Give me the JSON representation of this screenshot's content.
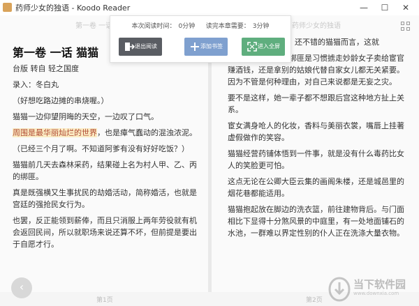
{
  "window": {
    "title": "药师少女的独语 - Koodo Reader",
    "controls": [
      "—",
      "☐",
      "✕"
    ]
  },
  "header_left": "第一卷 一话",
  "header_right": "药师少女的独语",
  "toolbar": {
    "read_time_label": "本次阅读时间：",
    "read_time_value": "0分钟",
    "remaining_label": "读完本章需要：",
    "remaining_value": "3分钟",
    "exit_label": "退出阅读",
    "bookmark_label": "添加书签",
    "fullscreen_label": "进入全屏"
  },
  "left_page": {
    "chapter_title": "第一卷 一话 猫猫",
    "paragraphs": [
      "台版 转自 轻之国度",
      "录入：冬白丸",
      "（好想吃路边摊的串烧喔。）",
      "猫猫一边仰望阴晦的天空，一边叹了口气。",
      "也是瘴气蠢动的混浊浓泥。",
      "（已经三个月了啊。不知道阿爹有没有好好吃饭？）",
      "猫猫前几天去森林采药，结果碰上名为村人甲、乙、丙的绑匪。",
      "真是既强横又生事扰民的劫婚活动，简称婚活，也就是宫廷的强抢民女行为。",
      "也罢，反正能领到薪俸，而且只消服上两年劳役就有机会返回民间，所以就职场来说还算不坏，但前提是要出于自愿才行。"
    ],
    "highlight": "周围是最华丽灿烂的世界",
    "page_label": "第1页"
  },
  "right_page": {
    "top_fragment": "还不错的猫猫而言，这就",
    "paragraphs": [
      "对猫猫而言，那些绑匪是习惯掳走妙龄女子卖给宦官赚酒钱，还是拿别的姑娘代替自家女儿都无关紧要。因为不管是何种理由，对自己来说都是无妄之灾。",
      "要不是这样，她一辈子都不想跟后宫这种地方扯上关系。",
      "宦女满身呛人的化妆，香料与美丽衣裳，嘴唇上挂著虚假做作的笑容。",
      "猫猫经营药铺体悟到一件事，就是没有什么毒药比女人的笑脸更可怕。",
      "这点无论在公卿大臣云集的画阁朱楼，还是城邑里的烟花巷都能适用。",
      "猫猫抱起放在脚边的洗衣篮，前往建物背后。与门面相比下显得十分煞风景的中庭里，有一处地面铺石的水池，一群难以界定性别的仆人正在洗涤大量衣物。"
    ],
    "page_label": "第2页"
  },
  "watermark": {
    "brand": "当下软件园",
    "url": "www.downxia.com"
  },
  "nav": {
    "prev": "‹"
  },
  "colors": {
    "exit_button": "#5a5d63",
    "bookmark_button": "#7fa0cf",
    "fullscreen_button": "#5fae7e",
    "highlight_bg": "#fbecc4"
  }
}
